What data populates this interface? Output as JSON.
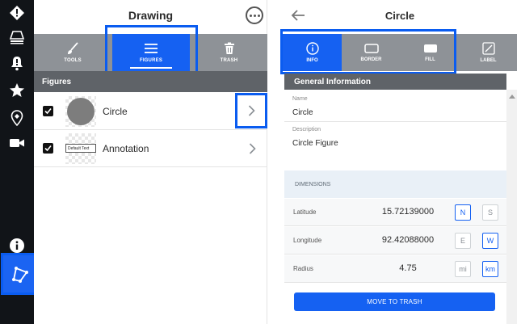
{
  "left_panel": {
    "title": "Drawing",
    "tabs": [
      {
        "label": "TOOLS",
        "icon": "brush-icon",
        "active": false
      },
      {
        "label": "FIGURES",
        "icon": "list-icon",
        "active": true
      },
      {
        "label": "TRASH",
        "icon": "trash-icon",
        "active": false
      }
    ],
    "section_title": "Figures",
    "figures": [
      {
        "label": "Circle",
        "checked": true,
        "thumb": "circle"
      },
      {
        "label": "Annotation",
        "checked": true,
        "thumb": "text",
        "thumb_text": "Default Text"
      }
    ]
  },
  "rail": {
    "icons": [
      "diamond-alert-icon",
      "layers-icon",
      "warning-bell-icon",
      "star-icon",
      "map-pin-icon",
      "video-icon",
      "info-icon",
      "draw-polygon-icon"
    ],
    "active": "draw-polygon-icon"
  },
  "right_panel": {
    "title": "Circle",
    "tabs": [
      {
        "label": "INFO",
        "icon": "info-icon",
        "active": true
      },
      {
        "label": "BORDER",
        "icon": "border-icon",
        "active": false
      },
      {
        "label": "FILL",
        "icon": "fill-icon",
        "active": false
      },
      {
        "label": "LABEL",
        "icon": "label-edit-icon",
        "active": false
      }
    ],
    "general_title": "General Information",
    "name_label": "Name",
    "name_value": "Circle",
    "description_label": "Description",
    "description_value": "Circle Figure",
    "dimensions_title": "DIMENSIONS",
    "dimensions": [
      {
        "label": "Latitude",
        "value": "15.72139000",
        "units": [
          {
            "t": "N",
            "on": true
          },
          {
            "t": "S",
            "on": false
          }
        ]
      },
      {
        "label": "Longitude",
        "value": "92.42088000",
        "units": [
          {
            "t": "E",
            "on": false
          },
          {
            "t": "W",
            "on": true
          }
        ]
      },
      {
        "label": "Radius",
        "value": "4.75",
        "units": [
          {
            "t": "mi",
            "on": false
          },
          {
            "t": "km",
            "on": true
          }
        ]
      }
    ],
    "trash_button": "MOVE TO TRASH"
  },
  "colors": {
    "accent": "#1561f2",
    "highlight": "#0a5cf0",
    "tab_bar": "#8e9297",
    "section": "#5f6368",
    "rail": "#111418"
  }
}
